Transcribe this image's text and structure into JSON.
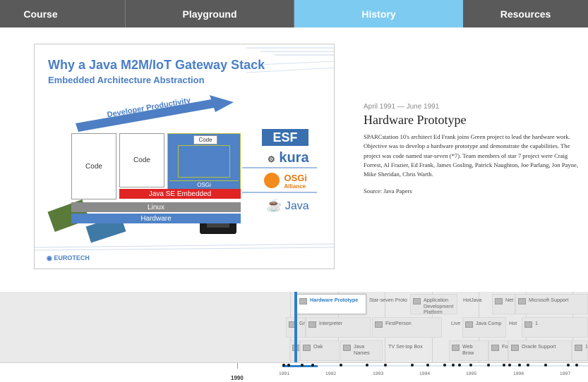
{
  "nav": {
    "tabs": [
      {
        "label": "Course"
      },
      {
        "label": "Playground"
      },
      {
        "label": "History"
      },
      {
        "label": "Resources"
      }
    ],
    "active_tab": "History",
    "active_color": "#7dcbf1",
    "inactive_color": "#5a5a5a"
  },
  "slide": {
    "title": "Why a Java M2M/IoT Gateway Stack",
    "subtitle": "Embedded Architecture Abstraction",
    "arrow_label": "Developer Productivity",
    "code_labels": [
      "Code",
      "Code",
      "Code"
    ],
    "osgi_label": "OSGi",
    "java_se_label": "Java SE Embedded",
    "linux_label": "Linux",
    "hardware_label": "Hardware",
    "brands": {
      "esf": "ESF",
      "kura": "kura",
      "osgi": "OSGi",
      "osgi_alliance": "Alliance",
      "java": "Java"
    },
    "footer": "EUROTECH"
  },
  "entry": {
    "dates": "April 1991 — June 1991",
    "title": "Hardware Prototype",
    "text": "SPARCstation 10's architect Ed Frank joins Green project to lead the hardware work. Objective was to develop a hardware prototype and demonstrate the capabilities. The project was code named star-seven (*7). Team members of star 7 project were Craig Forrest, Al Frazier, Ed Frank, James Gosling, Patrick Naughton, Joe Parlang, Jon Payne, Mike Sheridan, Chris Warth.",
    "source": "Source: Java Papers"
  },
  "timeline": {
    "items_row1": [
      {
        "label": "Hardware Prototype",
        "active": true
      },
      {
        "label": "Star-seven Proto"
      },
      {
        "label": "Application Development Platform"
      },
      {
        "label": "HotJava"
      },
      {
        "label": "Net"
      },
      {
        "label": "Microsoft Support"
      }
    ],
    "items_row2": [
      {
        "label": "Gr"
      },
      {
        "label": "Interpreter"
      },
      {
        "label": "FirstPerson"
      },
      {
        "label": "Live"
      },
      {
        "label": "Java Comp"
      },
      {
        "label": "Hot"
      },
      {
        "label": "1"
      }
    ],
    "items_row3": [
      {
        "label": ""
      },
      {
        "label": "Oak"
      },
      {
        "label": "Java Names"
      },
      {
        "label": "TV Set-top Box"
      },
      {
        "label": "Web Brow"
      },
      {
        "label": "Fo"
      },
      {
        "label": "Oracle Support"
      },
      {
        "label": "1"
      }
    ],
    "years": [
      "1990",
      "1991",
      "1992",
      "1993",
      "1994",
      "1995",
      "1996",
      "1997"
    ],
    "marker_color": "#2d7fc7"
  }
}
